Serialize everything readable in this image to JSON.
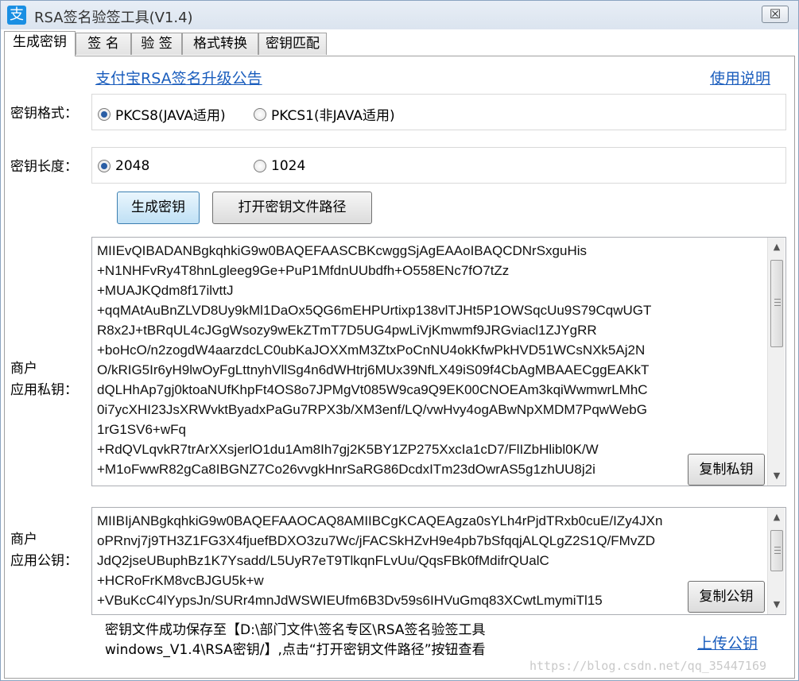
{
  "window": {
    "title": "RSA签名验签工具(V1.4)",
    "app_icon": "支",
    "close_glyph": "☒"
  },
  "tabs": [
    {
      "label": "生成密钥"
    },
    {
      "label": "签 名"
    },
    {
      "label": "验 签"
    },
    {
      "label": "格式转换"
    },
    {
      "label": "密钥匹配"
    }
  ],
  "links": {
    "announcement": "支付宝RSA签名升级公告",
    "help": "使用说明",
    "upload": "上传公钥"
  },
  "key_format": {
    "label": "密钥格式：",
    "options": [
      "PKCS8(JAVA适用)",
      "PKCS1(非JAVA适用)"
    ],
    "selected": 0
  },
  "key_length": {
    "label": "密钥长度：",
    "options": [
      "2048",
      "1024"
    ],
    "selected": 0
  },
  "buttons": {
    "generate": "生成密钥",
    "open_path": "打开密钥文件路径",
    "copy_private": "复制私钥",
    "copy_public": "复制公钥"
  },
  "private_key": {
    "label_line1": "商户",
    "label_line2": "应用私钥：",
    "lines": [
      "MIIEvQIBADANBgkqhkiG9w0BAQEFAASCBKcwggSjAgEAAoIBAQCDNrSxguHis",
      "+N1NHFvRy4T8hnLgleeg9Ge+PuP1MfdnUUbdfh+O558ENc7fO7tZz",
      "+MUAJKQdm8f17ilvttJ",
      "+qqMAtAuBnZLVD8Uy9kMl1DaOx5QG6mEHPUrtixp138vlTJHt5P1OWSqcUu9S79CqwUGT",
      "R8x2J+tBRqUL4cJGgWsozy9wEkZTmT7D5UG4pwLiVjKmwmf9JRGviacl1ZJYgRR",
      "+boHcO/n2zogdW4aarzdcLC0ubKaJOXXmM3ZtxPoCnNU4okKfwPkHVD51WCsNXk5Aj2N",
      "O/kRIG5Ir6yH9lwOyFgLttnyhVllSg4n6dWHtrj6MUx39NfLX49iS09f4CbAgMBAAECggEAKkT",
      "dQLHhAp7gj0ktoaNUfKhpFt4OS8o7JPMgVt085W9ca9Q9EK00CNOEAm3kqiWwmwrLMhC",
      "0i7ycXHI23JsXRWvktByadxPaGu7RPX3b/XM3enf/LQ/vwHvy4ogABwNpXMDM7PqwWebG",
      "1rG1SV6+wFq",
      "+RdQVLqvkR7trArXXsjerlO1du1Am8Ih7gj2K5BY1ZP275XxcIa1cD7/FlIZbHlibl0K/W",
      "+M1oFwwR82gCa8IBGNZ7Co26vvgkHnrSaRG86DcdxITm23dOwrAS5g1zhUU8j2i"
    ]
  },
  "public_key": {
    "label_line1": "商户",
    "label_line2": "应用公钥：",
    "lines": [
      "MIIBIjANBgkqhkiG9w0BAQEFAAOCAQ8AMIIBCgKCAQEAgza0sYLh4rPjdTRxb0cuE/IZy4JXn",
      "oPRnvj7j9TH3Z1FG3X4fjuefBDXO3zu7Wc/jFACSkHZvH9e4pb7bSfqqjALQLgZ2S1Q/FMvZD",
      "JdQ2jseUBuphBz1K7Ysadd/L5UyR7eT9TlkqnFLvUu/QqsFBk0fMdifrQUalC",
      "+HCRoFrKM8vcBJGU5k+w",
      "+VBuKcC4lYypsJn/SURr4mnJdWSWIEUfm6B3Dv59s6IHVuGmq83XCwtLmymiTl15"
    ]
  },
  "status": {
    "line1": "密钥文件成功保存至【D:\\部门文件\\签名专区\\RSA签名验签工具",
    "line2": "windows_V1.4\\RSA密钥/】,点击“打开密钥文件路径”按钮查看"
  },
  "watermark": "https://blog.csdn.net/qq_35447169"
}
